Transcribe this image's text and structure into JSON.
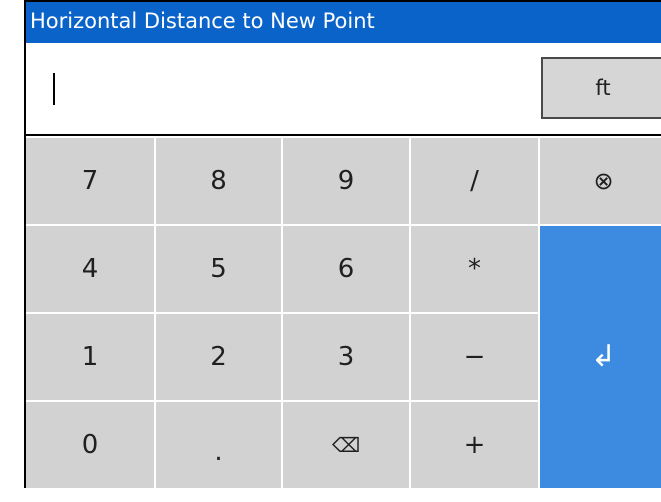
{
  "title": "Horizontal Distance to New Point",
  "input": {
    "value": "",
    "unit_label": "ft"
  },
  "keys": {
    "k7": "7",
    "k8": "8",
    "k9": "9",
    "slash": "/",
    "clear": "⊗",
    "k4": "4",
    "k5": "5",
    "k6": "6",
    "multiply": "*",
    "k1": "1",
    "k2": "2",
    "k3": "3",
    "minus": "−",
    "enter": "↲",
    "k0": "0",
    "dot": ".",
    "backspace": "⌫",
    "plus": "+"
  },
  "colors": {
    "title_bar": "#0a63c9",
    "key": "#d2d2d2",
    "enter_key": "#3c8be0"
  }
}
